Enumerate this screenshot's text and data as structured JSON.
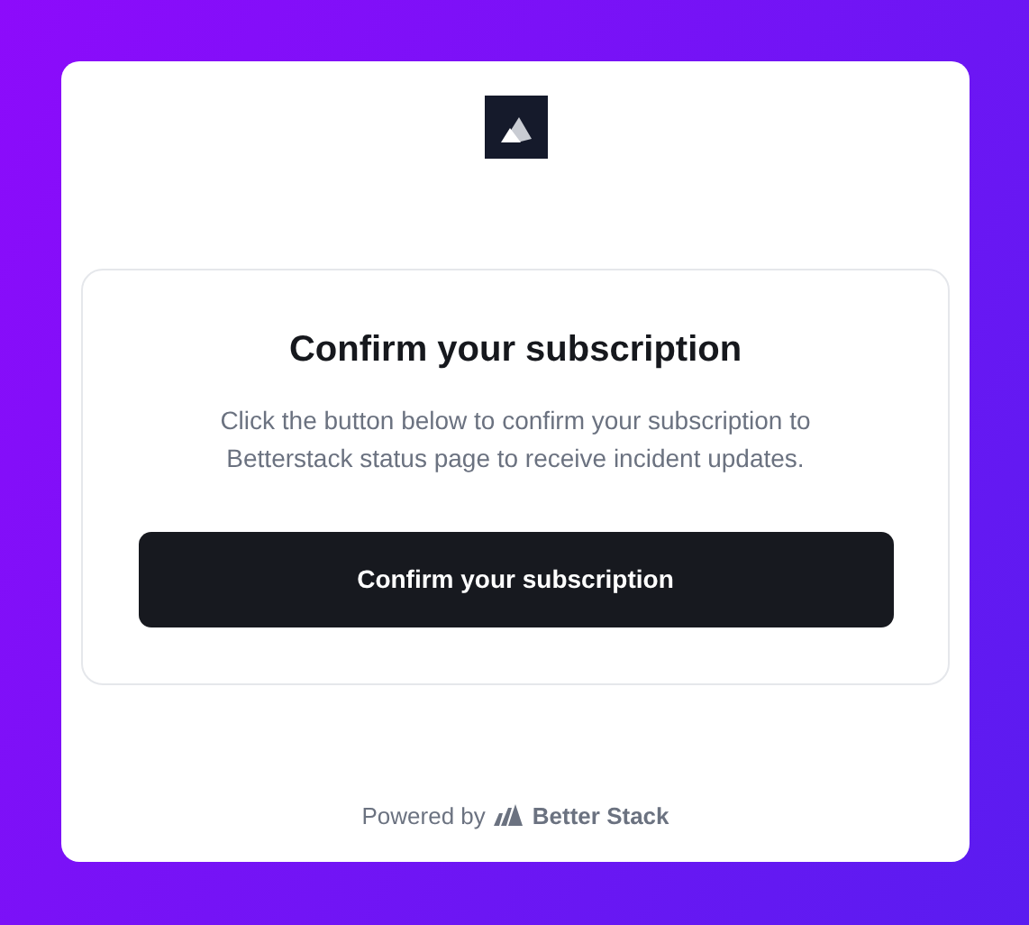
{
  "panel": {
    "title": "Confirm your subscription",
    "message": "Click the button below to confirm your subscription to Betterstack status page to receive incident updates.",
    "button": "Confirm your subscription"
  },
  "footer": {
    "powered_by": "Powered by",
    "brand": "Better Stack"
  }
}
